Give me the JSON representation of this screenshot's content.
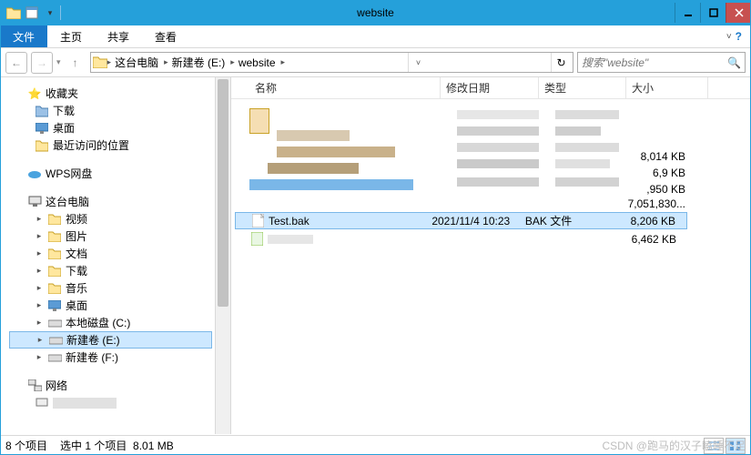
{
  "window": {
    "title": "website"
  },
  "menu": {
    "file": "文件",
    "home": "主页",
    "share": "共享",
    "view": "查看"
  },
  "address": {
    "crumb1": "这台电脑",
    "crumb2": "新建卷 (E:)",
    "crumb3": "website"
  },
  "search": {
    "placeholder": "搜索\"website\""
  },
  "nav": {
    "favorites": "收藏夹",
    "downloads": "下载",
    "desktop": "桌面",
    "recent": "最近访问的位置",
    "wps": "WPS网盘",
    "thispc": "这台电脑",
    "videos": "视频",
    "pictures": "图片",
    "documents": "文档",
    "downloads2": "下载",
    "music": "音乐",
    "desktop2": "桌面",
    "localC": "本地磁盘 (C:)",
    "volE": "新建卷 (E:)",
    "volF": "新建卷 (F:)",
    "network": "网络"
  },
  "columns": {
    "name": "名称",
    "date": "修改日期",
    "type": "类型",
    "size": "大小"
  },
  "sizes": {
    "r1": "8,014 KB",
    "r2": "6,9   KB",
    "r3": ",950 KB",
    "r4": "7,051,830...",
    "r6": "6,462 KB"
  },
  "selected_file": {
    "name": "Test.bak",
    "date": "2021/11/4 10:23",
    "type": "BAK 文件",
    "size": "8,206 KB"
  },
  "status": {
    "count": "8 个项目",
    "selection": "选中 1 个项目",
    "selsize": "8.01 MB"
  },
  "watermark": "CSDN @跑马的汉子瞌睡不足"
}
